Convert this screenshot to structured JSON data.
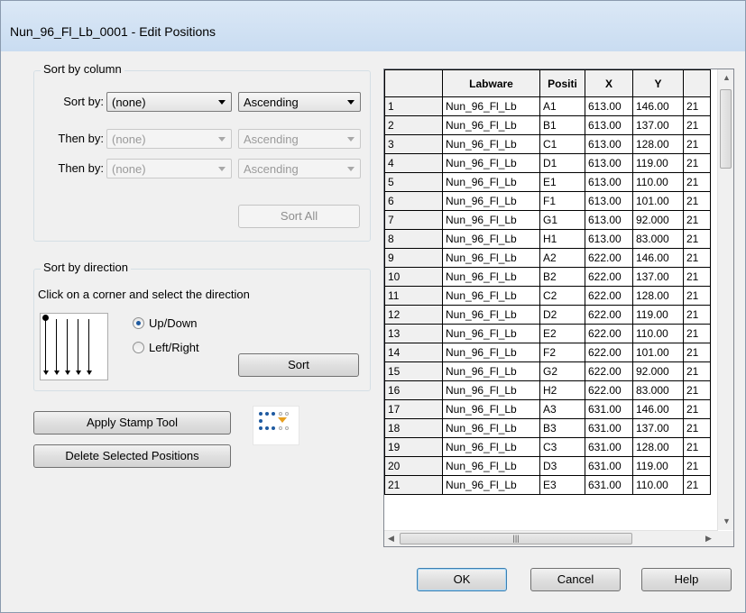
{
  "window": {
    "title": "Nun_96_Fl_Lb_0001 - Edit Positions"
  },
  "sort_by_column": {
    "legend": "Sort by column",
    "rows": [
      {
        "label": "Sort by:",
        "column": "(none)",
        "order": "Ascending",
        "enabled": true
      },
      {
        "label": "Then by:",
        "column": "(none)",
        "order": "Ascending",
        "enabled": false
      },
      {
        "label": "Then by:",
        "column": "(none)",
        "order": "Ascending",
        "enabled": false
      }
    ],
    "sort_all_label": "Sort All"
  },
  "sort_by_direction": {
    "legend": "Sort by direction",
    "instruction": "Click on a corner and select the direction",
    "options": [
      {
        "label": "Up/Down",
        "selected": true
      },
      {
        "label": "Left/Right",
        "selected": false
      }
    ],
    "sort_label": "Sort"
  },
  "actions": {
    "apply_stamp_label": "Apply Stamp Tool",
    "delete_selected_label": "Delete Selected Positions",
    "stamp_icon": "stamp-grid-icon"
  },
  "grid": {
    "columns": [
      "",
      "Labware",
      "Positi",
      "X",
      "Y",
      ""
    ],
    "rows": [
      [
        "1",
        "Nun_96_Fl_Lb",
        "A1",
        "613.00",
        "146.00",
        "21"
      ],
      [
        "2",
        "Nun_96_Fl_Lb",
        "B1",
        "613.00",
        "137.00",
        "21"
      ],
      [
        "3",
        "Nun_96_Fl_Lb",
        "C1",
        "613.00",
        "128.00",
        "21"
      ],
      [
        "4",
        "Nun_96_Fl_Lb",
        "D1",
        "613.00",
        "119.00",
        "21"
      ],
      [
        "5",
        "Nun_96_Fl_Lb",
        "E1",
        "613.00",
        "110.00",
        "21"
      ],
      [
        "6",
        "Nun_96_Fl_Lb",
        "F1",
        "613.00",
        "101.00",
        "21"
      ],
      [
        "7",
        "Nun_96_Fl_Lb",
        "G1",
        "613.00",
        "92.000",
        "21"
      ],
      [
        "8",
        "Nun_96_Fl_Lb",
        "H1",
        "613.00",
        "83.000",
        "21"
      ],
      [
        "9",
        "Nun_96_Fl_Lb",
        "A2",
        "622.00",
        "146.00",
        "21"
      ],
      [
        "10",
        "Nun_96_Fl_Lb",
        "B2",
        "622.00",
        "137.00",
        "21"
      ],
      [
        "11",
        "Nun_96_Fl_Lb",
        "C2",
        "622.00",
        "128.00",
        "21"
      ],
      [
        "12",
        "Nun_96_Fl_Lb",
        "D2",
        "622.00",
        "119.00",
        "21"
      ],
      [
        "13",
        "Nun_96_Fl_Lb",
        "E2",
        "622.00",
        "110.00",
        "21"
      ],
      [
        "14",
        "Nun_96_Fl_Lb",
        "F2",
        "622.00",
        "101.00",
        "21"
      ],
      [
        "15",
        "Nun_96_Fl_Lb",
        "G2",
        "622.00",
        "92.000",
        "21"
      ],
      [
        "16",
        "Nun_96_Fl_Lb",
        "H2",
        "622.00",
        "83.000",
        "21"
      ],
      [
        "17",
        "Nun_96_Fl_Lb",
        "A3",
        "631.00",
        "146.00",
        "21"
      ],
      [
        "18",
        "Nun_96_Fl_Lb",
        "B3",
        "631.00",
        "137.00",
        "21"
      ],
      [
        "19",
        "Nun_96_Fl_Lb",
        "C3",
        "631.00",
        "128.00",
        "21"
      ],
      [
        "20",
        "Nun_96_Fl_Lb",
        "D3",
        "631.00",
        "119.00",
        "21"
      ],
      [
        "21",
        "Nun_96_Fl_Lb",
        "E3",
        "631.00",
        "110.00",
        "21"
      ]
    ]
  },
  "footer": {
    "ok_label": "OK",
    "cancel_label": "Cancel",
    "help_label": "Help"
  }
}
